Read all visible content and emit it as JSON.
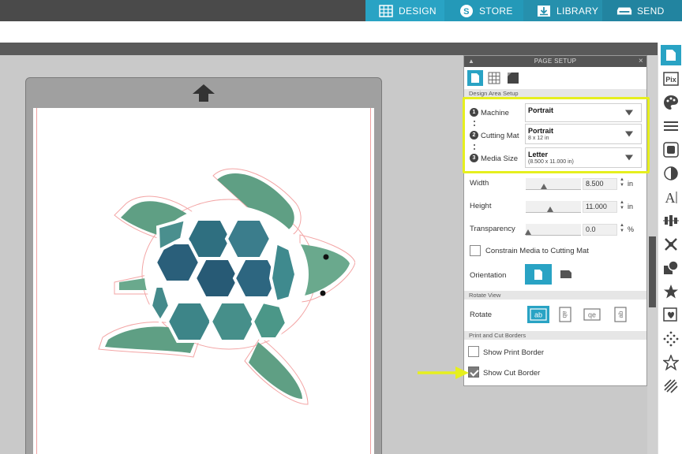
{
  "nav": {
    "tabs": [
      {
        "label": "DESIGN",
        "icon": "grid-icon",
        "active": true
      },
      {
        "label": "STORE",
        "icon": "store-s-icon"
      },
      {
        "label": "LIBRARY",
        "icon": "download-icon"
      },
      {
        "label": "SEND",
        "icon": "cutter-icon"
      }
    ]
  },
  "panel": {
    "title": "PAGE SETUP",
    "design_area_header": "Design Area Setup",
    "machine": {
      "step": "1",
      "label": "Machine",
      "value": "Portrait"
    },
    "cutting_mat": {
      "step": "2",
      "label": "Cutting Mat",
      "value": "Portrait",
      "sub": "8 x 12 in"
    },
    "media_size": {
      "step": "3",
      "label": "Media Size",
      "value": "Letter",
      "sub": "(8.500 x 11.000 in)"
    },
    "width": {
      "label": "Width",
      "value": "8.500",
      "unit": "in"
    },
    "height": {
      "label": "Height",
      "value": "11.000",
      "unit": "in"
    },
    "transparency": {
      "label": "Transparency",
      "value": "0.0",
      "unit": "%"
    },
    "constrain_label": "Constrain Media to Cutting Mat",
    "orientation_label": "Orientation",
    "rotate_view_header": "Rotate View",
    "rotate_label": "Rotate",
    "rotate_options": [
      "ab",
      "ab",
      "qe",
      "ab"
    ],
    "borders_header": "Print and Cut Borders",
    "show_print_border": {
      "label": "Show Print Border",
      "checked": false
    },
    "show_cut_border": {
      "label": "Show Cut Border",
      "checked": true
    }
  },
  "colors": {
    "accent": "#29a3c4",
    "highlight": "#e6ef1e",
    "topbar": "#4a4a4a"
  }
}
